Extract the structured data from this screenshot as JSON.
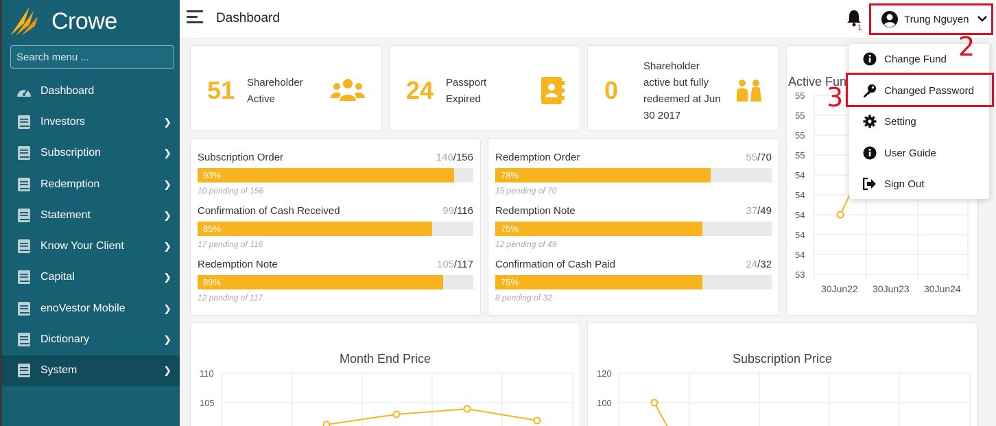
{
  "brand": {
    "name": "Crowe"
  },
  "sidebar": {
    "search_placeholder": "Search menu ...",
    "items": [
      {
        "label": "Dashboard",
        "icon": "dashboard-gauge-icon",
        "has_children": false
      },
      {
        "label": "Investors",
        "icon": "book-icon",
        "has_children": true
      },
      {
        "label": "Subscription",
        "icon": "book-icon",
        "has_children": true
      },
      {
        "label": "Redemption",
        "icon": "book-icon",
        "has_children": true
      },
      {
        "label": "Statement",
        "icon": "book-icon",
        "has_children": true
      },
      {
        "label": "Know Your Client",
        "icon": "book-icon",
        "has_children": true
      },
      {
        "label": "Capital",
        "icon": "book-icon",
        "has_children": true
      },
      {
        "label": "enoVestor Mobile",
        "icon": "book-icon",
        "has_children": true
      },
      {
        "label": "Dictionary",
        "icon": "book-icon",
        "has_children": true
      },
      {
        "label": "System",
        "icon": "book-icon",
        "has_children": true,
        "active": true
      }
    ]
  },
  "header": {
    "title": "Dashboard",
    "notification_count": "1",
    "user_name": "Trung Nguyen"
  },
  "stats": [
    {
      "value": "51",
      "label_line1": "Shareholder",
      "label_line2": "Active",
      "icon": "users-group-icon"
    },
    {
      "value": "24",
      "label_line1": "Passport",
      "label_line2": "Expired",
      "icon": "address-book-icon"
    },
    {
      "value": "0",
      "label_lines": [
        "Shareholder",
        "active but fully",
        "redeemed at Jun",
        "30 2017"
      ],
      "icon": "people-pair-icon"
    }
  ],
  "progress_left": [
    {
      "label": "Subscription Order",
      "done": "146",
      "total": "/156",
      "percent_text": "93%",
      "percent": 93,
      "pending": "10 pending of 156"
    },
    {
      "label": "Confirmation of Cash Received",
      "done": "99",
      "total": "/116",
      "percent_text": "85%",
      "percent": 85,
      "pending": "17 pending of 116"
    },
    {
      "label": "Redemption Note",
      "done": "105",
      "total": "/117",
      "percent_text": "89%",
      "percent": 89,
      "pending": "12 pending of 117"
    }
  ],
  "progress_right": [
    {
      "label": "Redemption Order",
      "done": "55",
      "total": "/70",
      "percent_text": "78%",
      "percent": 78,
      "pending": "15 pending of 70"
    },
    {
      "label": "Redemption Note",
      "done": "37",
      "total": "/49",
      "percent_text": "75%",
      "percent": 75,
      "pending": "12 pending of 49"
    },
    {
      "label": "Confirmation of Cash Paid",
      "done": "24",
      "total": "/32",
      "percent_text": "75%",
      "percent": 75,
      "pending": "8 pending of 32"
    }
  ],
  "active_fund_chart": {
    "title_partial": "Active Fun",
    "y_ticks": [
      "55",
      "55",
      "55",
      "55",
      "54",
      "54",
      "54",
      "54",
      "54",
      "53"
    ],
    "x_ticks": [
      "30Jun22",
      "30Jun23",
      "30Jun24"
    ]
  },
  "month_end_chart": {
    "title": "Month End Price",
    "y_ticks": [
      "110",
      "105"
    ]
  },
  "subscription_chart": {
    "title": "Subscription Price",
    "y_ticks": [
      "120",
      "100"
    ]
  },
  "user_menu": {
    "items": [
      {
        "label": "Change Fund",
        "icon": "info-circle-icon"
      },
      {
        "label": "Changed Password",
        "icon": "key-icon"
      },
      {
        "label": "Setting",
        "icon": "gear-icon"
      },
      {
        "label": "User Guide",
        "icon": "info-circle-icon"
      },
      {
        "label": "Sign Out",
        "icon": "sign-out-icon"
      }
    ]
  },
  "annotations": {
    "step2": "2",
    "step3": "3"
  },
  "colors": {
    "sidebar": "#175f72",
    "accent": "#f7b41e",
    "highlight": "#e01020"
  }
}
